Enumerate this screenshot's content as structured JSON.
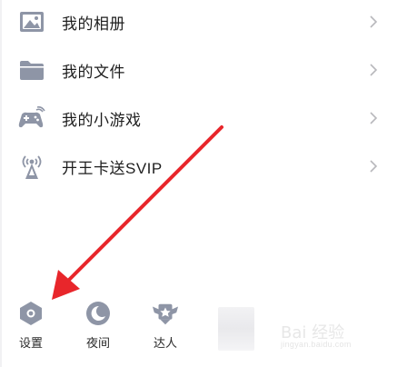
{
  "menu": {
    "items": [
      {
        "label": "我的相册",
        "icon": "photo-album-icon"
      },
      {
        "label": "我的文件",
        "icon": "folder-icon"
      },
      {
        "label": "我的小游戏",
        "icon": "gamepad-icon"
      },
      {
        "label": "开王卡送SVIP",
        "icon": "signal-tower-icon"
      }
    ],
    "chevron_icon": "chevron-right-icon"
  },
  "bottom_bar": {
    "items": [
      {
        "label": "设置",
        "icon": "hexagon-gear-icon"
      },
      {
        "label": "夜间",
        "icon": "moon-icon"
      },
      {
        "label": "达人",
        "icon": "winged-badge-icon"
      }
    ]
  },
  "annotation": {
    "color": "#e8262b",
    "icon": "red-arrow-annotation"
  },
  "watermark": {
    "title": "Bai 经验",
    "url": "jingyan.baidu.com"
  },
  "colors": {
    "icon_gray": "#8e95a6",
    "text": "#1e1e1e",
    "chevron": "#b8b8bc"
  }
}
